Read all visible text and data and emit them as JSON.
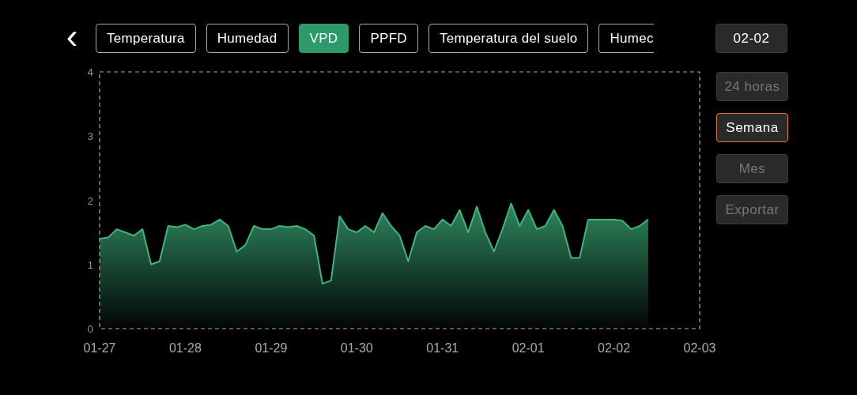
{
  "back_button": {
    "label": "‹"
  },
  "tabs": [
    {
      "label": "Temperatura",
      "selected": false
    },
    {
      "label": "Humedad",
      "selected": false
    },
    {
      "label": "VPD",
      "selected": true
    },
    {
      "label": "PPFD",
      "selected": false
    },
    {
      "label": "Temperatura del suelo",
      "selected": false
    },
    {
      "label": "Humec",
      "selected": false
    }
  ],
  "date_button": {
    "label": "02-02"
  },
  "range_buttons": [
    {
      "label": "24 horas",
      "selected": false
    },
    {
      "label": "Semana",
      "selected": true
    },
    {
      "label": "Mes",
      "selected": false
    },
    {
      "label": "Exportar",
      "selected": false
    }
  ],
  "chart_data": {
    "type": "area",
    "ylim": [
      0,
      4
    ],
    "yticks": [
      0,
      1,
      2,
      3,
      4
    ],
    "categories": [
      "01-27",
      null,
      null,
      null,
      null,
      null,
      null,
      null,
      null,
      null,
      "01-28",
      null,
      null,
      null,
      null,
      null,
      null,
      null,
      null,
      null,
      "01-29",
      null,
      null,
      null,
      null,
      null,
      null,
      null,
      null,
      null,
      "01-30",
      null,
      null,
      null,
      null,
      null,
      null,
      null,
      null,
      null,
      "01-31",
      null,
      null,
      null,
      null,
      null,
      null,
      null,
      null,
      null,
      "02-01",
      null,
      null,
      null,
      null,
      null,
      null,
      null,
      null,
      null,
      "02-02",
      null,
      null,
      null,
      null,
      null,
      null,
      null,
      null,
      null,
      "02-03"
    ],
    "series": [
      {
        "color": "#3fb57f",
        "values": [
          1.4,
          1.42,
          1.55,
          1.5,
          1.45,
          1.55,
          1.0,
          1.05,
          1.6,
          1.58,
          1.62,
          1.55,
          1.6,
          1.62,
          1.7,
          1.6,
          1.2,
          1.3,
          1.6,
          1.55,
          1.55,
          1.6,
          1.58,
          1.6,
          1.55,
          1.45,
          0.7,
          0.75,
          1.75,
          1.55,
          1.5,
          1.6,
          1.5,
          1.8,
          1.6,
          1.45,
          1.05,
          1.5,
          1.6,
          1.55,
          1.7,
          1.6,
          1.85,
          1.5,
          1.9,
          1.5,
          1.2,
          1.55,
          1.95,
          1.6,
          1.85,
          1.55,
          1.6,
          1.85,
          1.6,
          1.1,
          1.1,
          1.7,
          1.7,
          1.7,
          1.7,
          1.68,
          1.55,
          1.6,
          1.7,
          null,
          null,
          null,
          null,
          null,
          null
        ]
      }
    ]
  }
}
